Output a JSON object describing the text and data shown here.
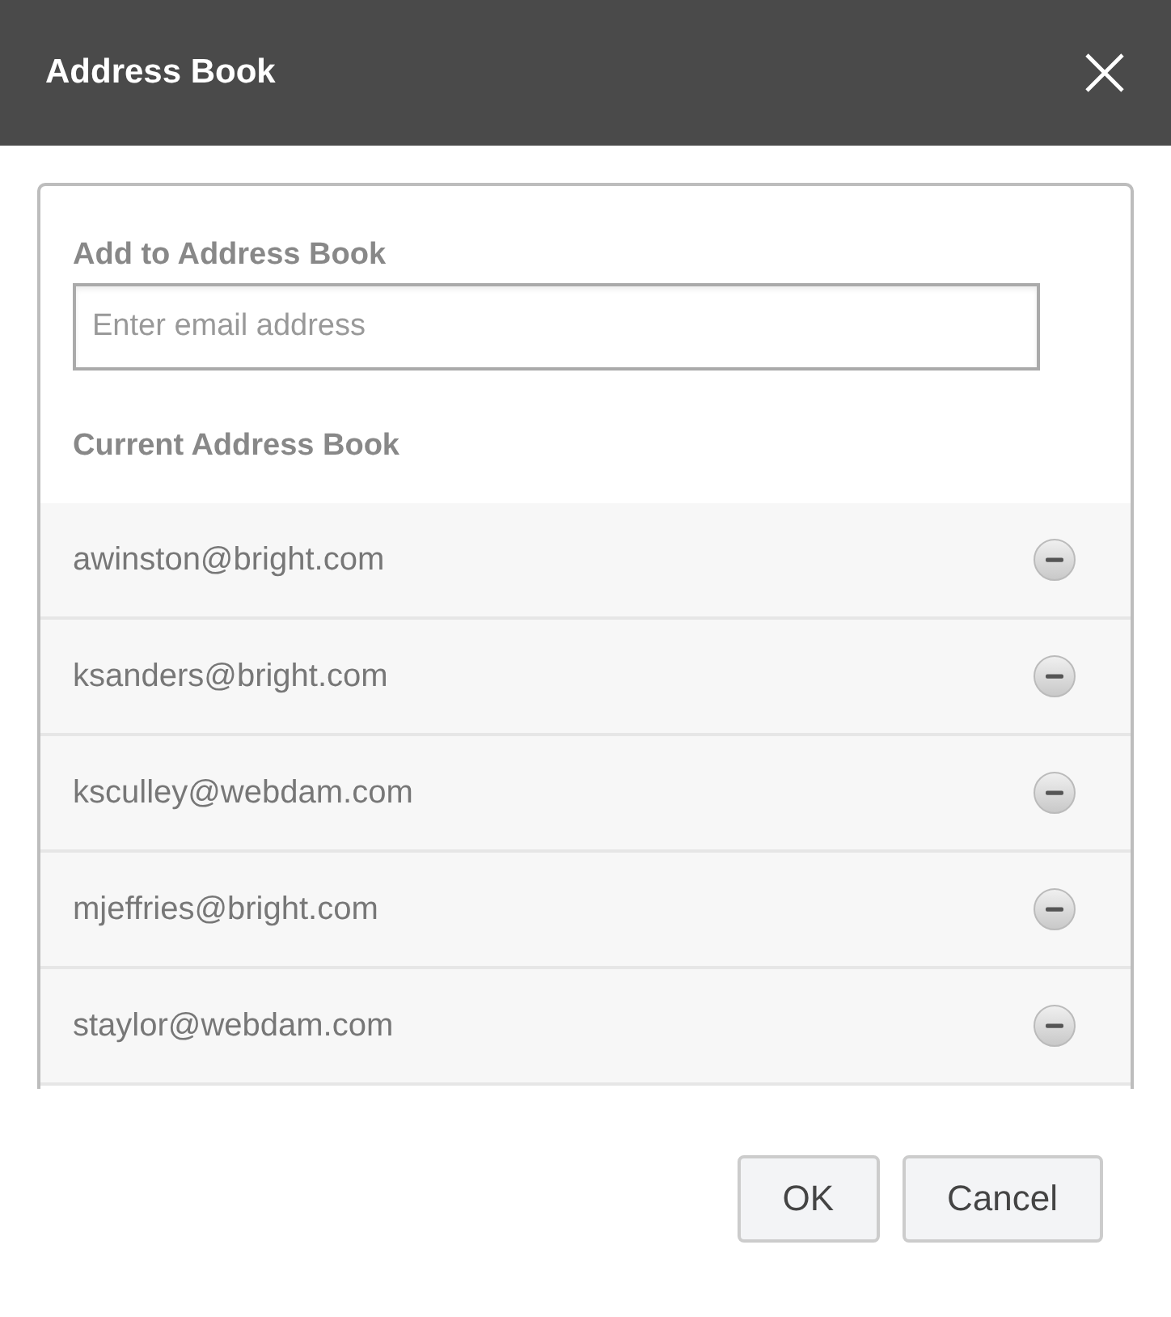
{
  "window": {
    "title": "Address Book"
  },
  "add_section": {
    "label": "Add to Address Book",
    "placeholder": "Enter email address"
  },
  "current_section": {
    "label": "Current Address Book"
  },
  "contacts": [
    {
      "email": "awinston@bright.com"
    },
    {
      "email": "ksanders@bright.com"
    },
    {
      "email": "ksculley@webdam.com"
    },
    {
      "email": "mjeffries@bright.com"
    },
    {
      "email": "staylor@webdam.com"
    }
  ],
  "buttons": [
    {
      "label": "OK"
    },
    {
      "label": "Cancel"
    }
  ]
}
